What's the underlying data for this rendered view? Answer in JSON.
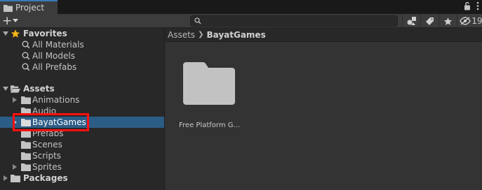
{
  "window": {
    "tab_title": "Project",
    "tab_icon": "folder-icon"
  },
  "toolbar": {
    "add_label": "+",
    "search_placeholder": "",
    "hidden_count": "19"
  },
  "tree": {
    "favorites": {
      "label": "Favorites",
      "items": [
        "All Materials",
        "All Models",
        "All Prefabs"
      ]
    },
    "assets": {
      "label": "Assets",
      "items": [
        {
          "label": "Animations",
          "expandable": true
        },
        {
          "label": "Audio",
          "expandable": false
        },
        {
          "label": "BayatGames",
          "expandable": true,
          "selected": true
        },
        {
          "label": "Prefabs",
          "expandable": false
        },
        {
          "label": "Scenes",
          "expandable": false
        },
        {
          "label": "Scripts",
          "expandable": false
        },
        {
          "label": "Sprites",
          "expandable": true
        }
      ]
    },
    "packages": {
      "label": "Packages"
    }
  },
  "breadcrumb": {
    "root": "Assets",
    "current": "BayatGames"
  },
  "content": {
    "items": [
      {
        "label": "Free Platform G...",
        "icon": "folder-icon"
      }
    ]
  },
  "colors": {
    "selection": "#2c5d87",
    "highlight": "#ff1010",
    "star": "#f2b418"
  }
}
